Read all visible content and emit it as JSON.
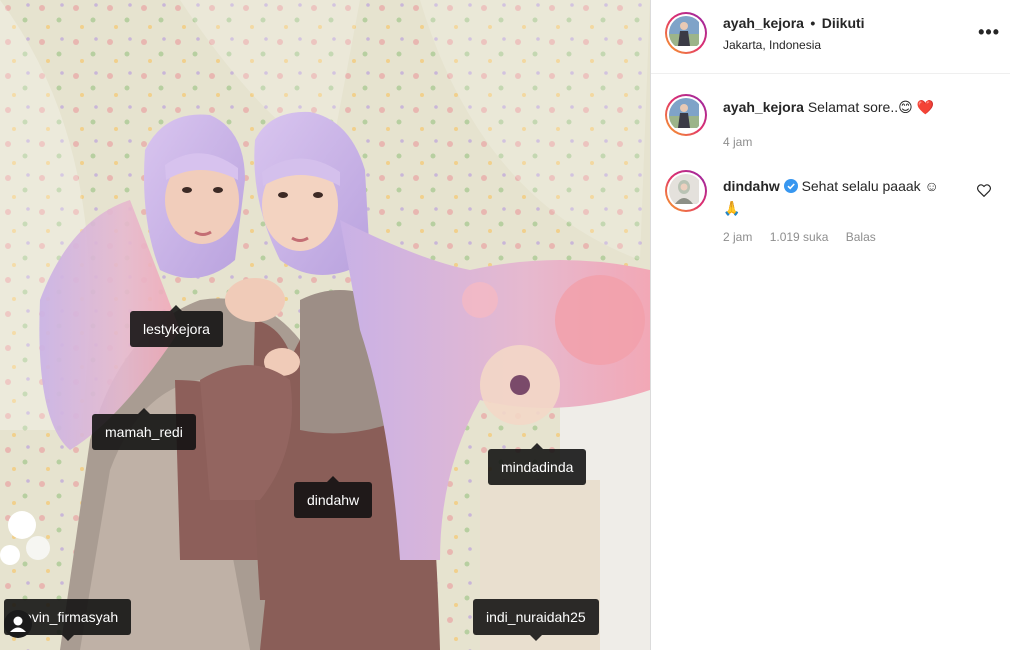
{
  "post": {
    "tags": [
      {
        "label": "lestykejora"
      },
      {
        "label": "mamah_redi"
      },
      {
        "label": "mindadinda"
      },
      {
        "label": "dindahw"
      },
      {
        "label": "kevin_firmasyah"
      },
      {
        "label": "indi_nuraidah25"
      }
    ]
  },
  "header": {
    "username": "ayah_kejora",
    "follow_sep": "•",
    "follow_status": "Diikuti",
    "location": "Jakarta, Indonesia",
    "more_icon": "more-horizontal-icon"
  },
  "caption": {
    "username": "ayah_kejora",
    "text": "Selamat sore..",
    "emojis": "😊 ❤️",
    "time": "4 jam"
  },
  "comments": [
    {
      "username": "dindahw",
      "verified_icon": "verified-badge-icon",
      "text": "Sehat selalu paaak ☺",
      "text_line2": "🙏",
      "time": "2 jam",
      "likes": "1.019 suka",
      "reply": "Balas",
      "like_icon": "heart-outline-icon"
    }
  ],
  "colors": {
    "story_ring_start": "#f9a825",
    "story_ring_mid": "#e1306c",
    "story_ring_end": "#8e24aa",
    "verified": "#3897f0",
    "text": "#262626",
    "muted": "#8e8e8e"
  }
}
